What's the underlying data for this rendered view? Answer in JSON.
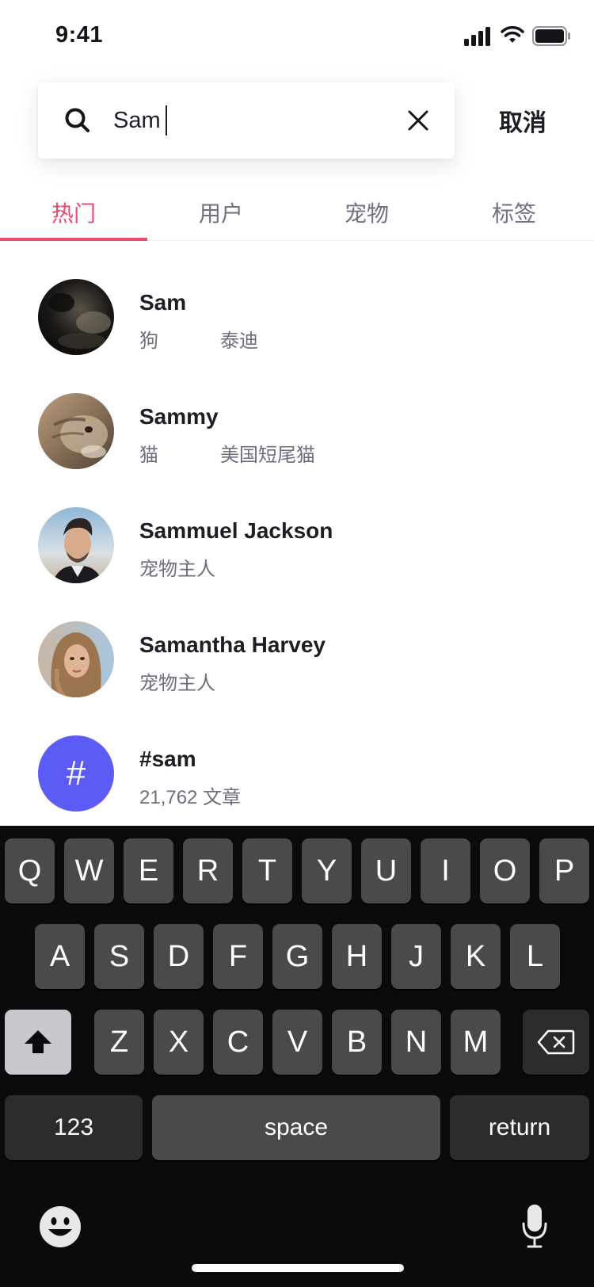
{
  "status_bar": {
    "time": "9:41"
  },
  "search": {
    "value": "Sam",
    "cancel_label": "取消"
  },
  "tabs": [
    {
      "label": "热门",
      "active": true
    },
    {
      "label": "用户",
      "active": false
    },
    {
      "label": "宠物",
      "active": false
    },
    {
      "label": "标签",
      "active": false
    }
  ],
  "results": [
    {
      "name": "Sam",
      "sub1": "狗",
      "sub2": "泰迪",
      "avatar": "dark-cat-photo"
    },
    {
      "name": "Sammy",
      "sub1": "猫",
      "sub2": "美国短尾猫",
      "avatar": "tabby-cat-photo"
    },
    {
      "name": "Sammuel Jackson",
      "sub1": "宠物主人",
      "sub2": "",
      "avatar": "man-portrait-photo"
    },
    {
      "name": "Samantha Harvey",
      "sub1": "宠物主人",
      "sub2": "",
      "avatar": "woman-portrait-photo"
    },
    {
      "name": "#sam",
      "sub1": "21,762 文章",
      "sub2": "",
      "avatar": "hash-icon",
      "avatar_glyph": "#"
    }
  ],
  "keyboard": {
    "row1": [
      "Q",
      "W",
      "E",
      "R",
      "T",
      "Y",
      "U",
      "I",
      "O",
      "P"
    ],
    "row2": [
      "A",
      "S",
      "D",
      "F",
      "G",
      "H",
      "J",
      "K",
      "L"
    ],
    "row3": [
      "Z",
      "X",
      "C",
      "V",
      "B",
      "N",
      "M"
    ],
    "numbers_label": "123",
    "space_label": "space",
    "return_label": "return"
  },
  "colors": {
    "accent": "#ea4b6d",
    "hashtag_bg": "#5d5bf5",
    "keyboard_bg": "#0b0b0d",
    "key_bg": "#4a4a4c"
  }
}
